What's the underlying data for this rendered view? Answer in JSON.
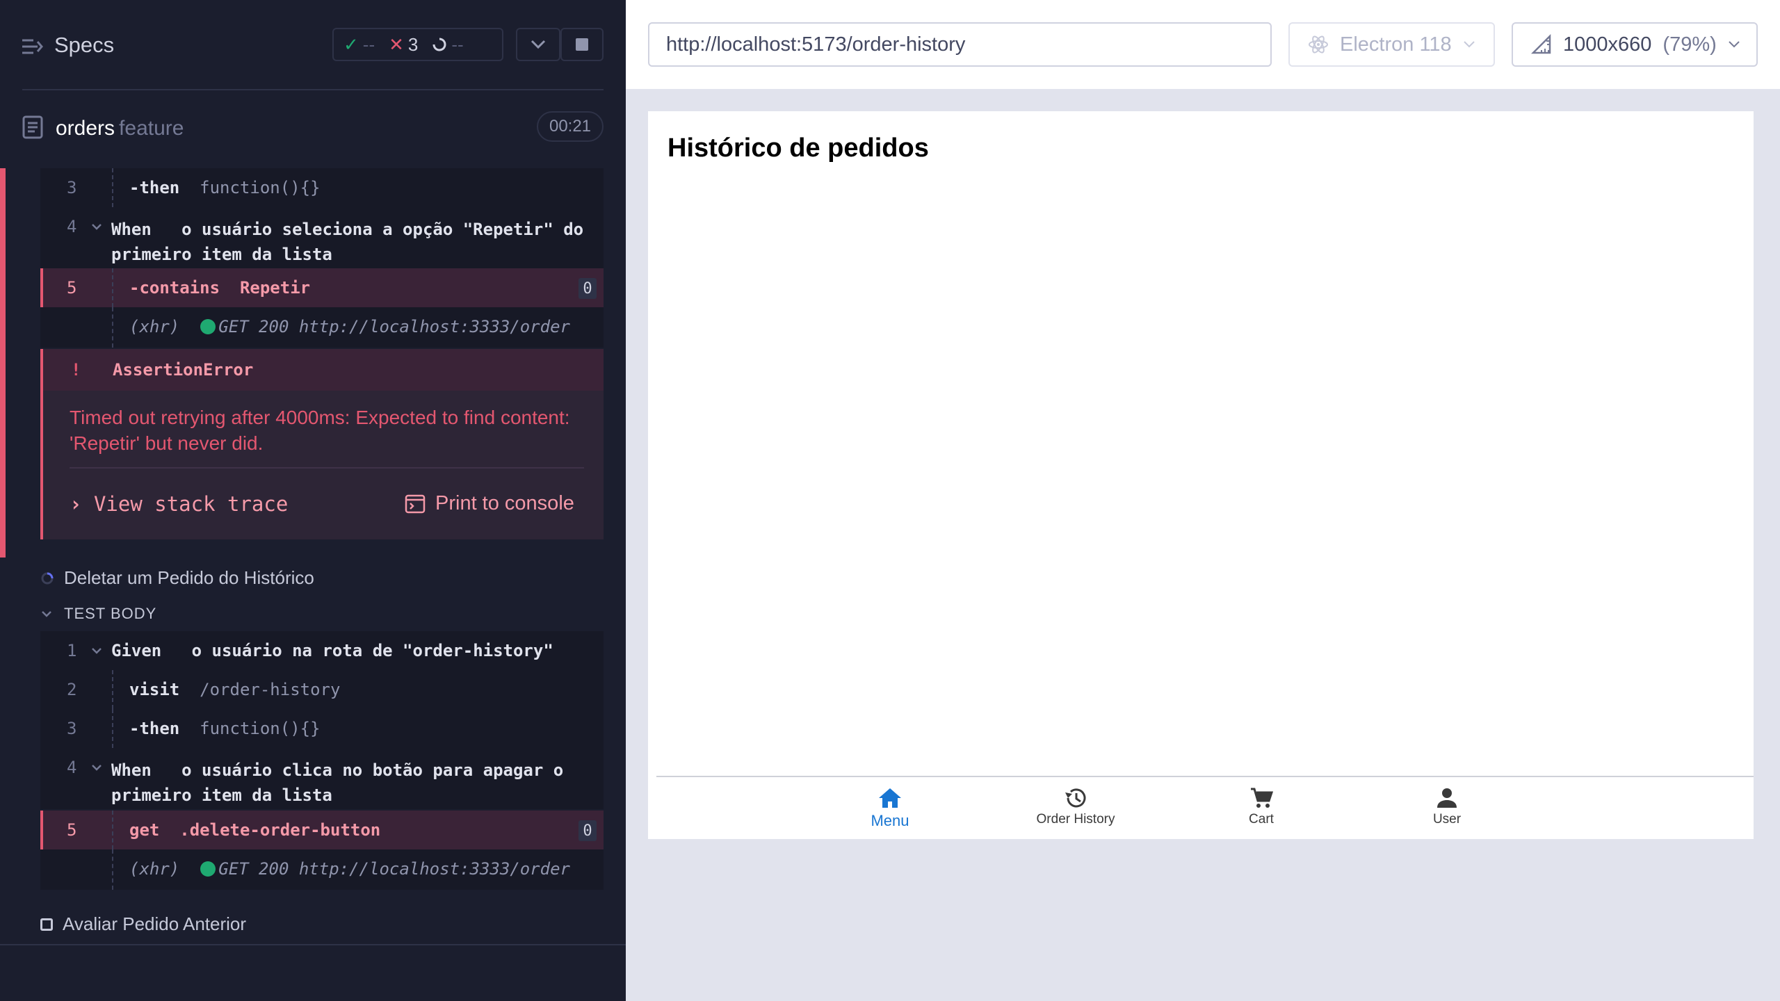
{
  "reporter": {
    "header": {
      "title": "Specs",
      "passed": "--",
      "failed": "3",
      "pending": "--"
    },
    "spec": {
      "name": "orders",
      "ext": "feature",
      "duration": "00:21"
    },
    "first_test": {
      "commands": [
        {
          "num": "3",
          "kw": "-then",
          "arg": "function(){}"
        },
        {
          "num": "4",
          "kw": "When",
          "line1": "o usuário seleciona a opção \"Repetir\" do",
          "line2": "primeiro item da lista"
        },
        {
          "num": "5",
          "kw": "-contains",
          "arg": "Repetir",
          "badge": "0"
        }
      ],
      "xhr": {
        "label": "(xhr)",
        "text": "GET 200 http://localhost:3333/order"
      },
      "error": {
        "bang": "!",
        "title": "AssertionError",
        "message": "Timed out retrying after 4000ms: Expected to find content: 'Repetir' but never did.",
        "stack_label": "View stack trace",
        "print_label": "Print to console"
      }
    },
    "second_test": {
      "title": "Deletar um Pedido do Histórico",
      "section": "TEST BODY",
      "commands": [
        {
          "num": "1",
          "kw": "Given",
          "arg": "o usuário na rota de \"order-history\""
        },
        {
          "num": "2",
          "kw": "visit",
          "arg": "/order-history"
        },
        {
          "num": "3",
          "kw": "-then",
          "arg": "function(){}"
        },
        {
          "num": "4",
          "kw": "When",
          "line1": "o usuário clica no botão para apagar o",
          "line2": "primeiro item da lista"
        },
        {
          "num": "5",
          "kw": "get",
          "arg": ".delete-order-button",
          "badge": "0"
        }
      ],
      "xhr": {
        "label": "(xhr)",
        "text": "GET 200 http://localhost:3333/order"
      }
    },
    "third_test": {
      "title": "Avaliar Pedido Anterior"
    }
  },
  "aut": {
    "url": "http://localhost:5173/order-history",
    "browser": "Electron 118",
    "viewport": "1000x660",
    "zoom": "(79%)",
    "page": {
      "heading": "Histórico de pedidos",
      "nav": [
        {
          "label": "Menu",
          "icon": "home-icon",
          "active": true
        },
        {
          "label": "Order History",
          "icon": "history-icon",
          "active": false
        },
        {
          "label": "Cart",
          "icon": "cart-icon",
          "active": false
        },
        {
          "label": "User",
          "icon": "user-icon",
          "active": false
        }
      ]
    }
  },
  "colors": {
    "reporter_bg": "#1b1e2e",
    "fail": "#e45770",
    "pass": "#1fa971",
    "active_nav": "#1976d2"
  }
}
